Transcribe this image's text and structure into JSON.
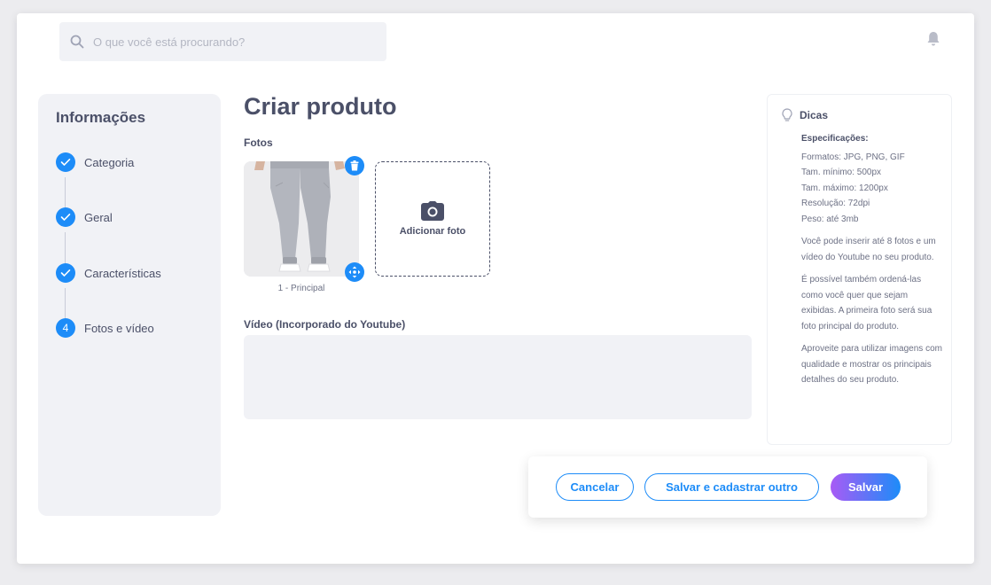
{
  "search": {
    "placeholder": "O que você está procurando?"
  },
  "sidebar": {
    "title": "Informações",
    "steps": [
      {
        "label": "Categoria",
        "state": "done"
      },
      {
        "label": "Geral",
        "state": "done"
      },
      {
        "label": "Características",
        "state": "done"
      },
      {
        "label": "Fotos e vídeo",
        "state": "current",
        "number": "4"
      }
    ]
  },
  "main": {
    "title": "Criar produto",
    "photos_label": "Fotos",
    "photo_caption": "1 - Principal",
    "add_photo_label": "Adicionar foto",
    "video_label": "Vídeo (Incorporado do Youtube)"
  },
  "tips": {
    "title": "Dicas",
    "spec_title": "Especificações:",
    "specs": [
      "Formatos: JPG, PNG, GIF",
      "Tam. mínimo: 500px",
      "Tam. máximo: 1200px",
      "Resolução: 72dpi",
      "Peso: até 3mb"
    ],
    "paragraphs": [
      "Você pode inserir até 8 fotos e um vídeo do Youtube no seu produto.",
      "É possível também ordená-las como você quer que sejam exibidas. A primeira foto será sua foto principal do produto.",
      "Aproveite para utilizar imagens com qualidade e mostrar os principais detalhes do seu produto."
    ]
  },
  "actions": {
    "cancel_label": "Cancelar",
    "save_and_new_label": "Salvar e cadastrar outro",
    "save_label": "Salvar"
  },
  "colors": {
    "accent": "#1d8cf8",
    "gradient_start": "#a85bf5",
    "text": "#4b5068",
    "panel": "#f1f2f6"
  }
}
